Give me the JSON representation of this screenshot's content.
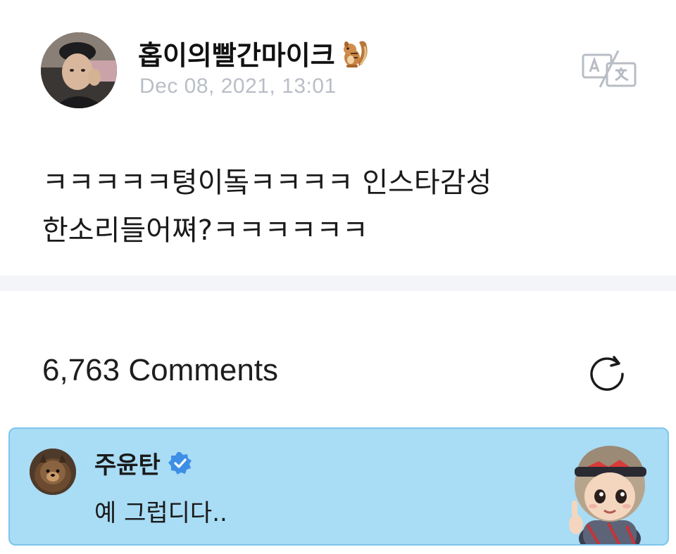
{
  "post": {
    "author_name": "홉이의빨간마이크",
    "author_emoji": "chipmunk-emoji",
    "timestamp": "Dec 08, 2021, 13:01",
    "translate_icon": "translate-icon",
    "body": "ㅋㅋㅋㅋㅋ텽이돜ㅋㅋㅋㅋ 인스타감성 한소리들어쪄?ㅋㅋㅋㅋㅋㅋ"
  },
  "comments": {
    "count_label": "6,763 Comments",
    "refresh_icon": "refresh-icon",
    "highlighted": {
      "author_name": "주윤탄",
      "verified_icon": "verified-badge-icon",
      "text": "예 그럽디다..",
      "sticker": "character-sticker"
    }
  },
  "colors": {
    "highlight_bg": "#a9dcf5",
    "highlight_border": "#7cc6ef",
    "verified_blue": "#3d8fe6",
    "timestamp_gray": "#b9bec6",
    "divider": "#f4f5f8"
  }
}
